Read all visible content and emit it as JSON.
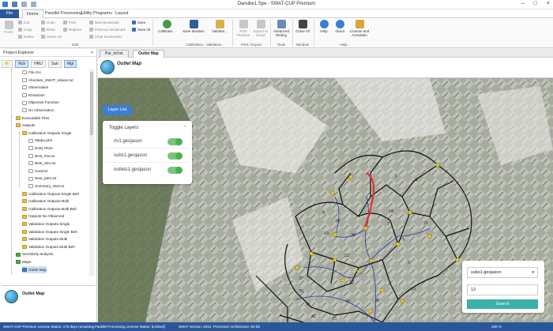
{
  "window": {
    "title": "Danube1.Spe - SWAT-CUP Premium"
  },
  "tabs": {
    "file": "File",
    "home": "Home",
    "parallel": "Parallel Processing",
    "utility": "Utility Programs",
    "layout": "Layout"
  },
  "ribbon": {
    "paste": "Paste",
    "cut": "Cut",
    "copy": "Copy",
    "delete": "Delete",
    "undo": "Undo",
    "redo": "Redo",
    "select_all": "Select All",
    "find": "Find",
    "replace": "Replace",
    "next_bookmark": "Next Bookmark",
    "previous_bookmark": "Previous Bookmark",
    "clear_bookmarks": "Clear Bookmarks",
    "save": "Save",
    "save_all": "Save All",
    "calibrate": "Calibrate...",
    "save_iteration": "Save Iteration",
    "validate": "Validate...",
    "print_preview": "Print Preview",
    "export_excel": "Export to Excel",
    "advanced_writing": "Advanced Writing",
    "close_all": "Close All",
    "help": "Help",
    "about": "About",
    "license": "License and Activation",
    "group_edit": "Edit",
    "group_calibration": "Calibration - Validation",
    "group_print": "Print / Export",
    "group_tools": "Tools",
    "group_window": "Window",
    "group_help": "Help"
  },
  "explorer": {
    "title": "Project Explorer",
    "close": "×",
    "tabs": [
      "Rch",
      "HRU",
      "Sub",
      "Mgt"
    ],
    "items": [
      {
        "label": "File.Cio",
        "type": "file"
      },
      {
        "label": "Absolute_SWAT_Values.txt",
        "type": "file"
      },
      {
        "label": "Observation",
        "type": "file"
      },
      {
        "label": "Extraction",
        "type": "file"
      },
      {
        "label": "Objective Function",
        "type": "file"
      },
      {
        "label": "No Observation",
        "type": "file"
      },
      {
        "label": "Executable Files",
        "type": "folder"
      },
      {
        "label": "Outputs",
        "type": "folder"
      },
      {
        "label": "Calibration Outputs Single",
        "type": "folder"
      },
      {
        "label": "95ppu.plot",
        "type": "file"
      },
      {
        "label": "Dotty Plots",
        "type": "file"
      },
      {
        "label": "Best_Par.txt",
        "type": "file"
      },
      {
        "label": "Best_Sim.txt",
        "type": "file"
      },
      {
        "label": "Goal.txt",
        "type": "file"
      },
      {
        "label": "New_pars.txt",
        "type": "file"
      },
      {
        "label": "Summary_Stat.txt",
        "type": "file"
      },
      {
        "label": "Calibration Outputs Single Beh",
        "type": "folder"
      },
      {
        "label": "Calibration Outputs Multi",
        "type": "folder"
      },
      {
        "label": "Calibration Outputs Multi Beh",
        "type": "folder"
      },
      {
        "label": "Outputs No Observed",
        "type": "folder"
      },
      {
        "label": "Validation Outputs Single",
        "type": "folder"
      },
      {
        "label": "Validation Outputs Single Beh",
        "type": "folder"
      },
      {
        "label": "Validation Outputs Multi",
        "type": "folder"
      },
      {
        "label": "Validation Outputs Multi Beh",
        "type": "folder"
      },
      {
        "label": "Sensitivity analysis",
        "type": "green"
      },
      {
        "label": "Maps",
        "type": "green"
      },
      {
        "label": "Outlet Map",
        "type": "blue"
      }
    ],
    "preview_label": "Outlet Map"
  },
  "doc_tabs": [
    "Par_inf.txt",
    "Outlet Map"
  ],
  "map": {
    "title": "Outlet Map",
    "layer_button": "Layer List",
    "toggle_title": "Toggle Layers",
    "toggle_close": "×",
    "layers": [
      "riv1.geojason",
      "subs1.geojason",
      "outlets1.geojason"
    ],
    "search_select": "subs1.geojason",
    "search_value": "12",
    "search_button": "Search",
    "sub_numbers": [
      "1",
      "2",
      "18",
      "9",
      "10",
      "7",
      "6",
      "13",
      "36",
      "37",
      "39",
      "41",
      "40",
      "42",
      "53",
      "5",
      "12",
      "38",
      "15",
      "21",
      "22"
    ]
  },
  "status": {
    "license": "SWAT-CUP Premium License Status: 179 days remaining",
    "parallel": "Parallel Processing License Status: [Limited]",
    "version": "SWAT Version: 2012, Processor Architecture: 64-bit",
    "zoom": "100 %"
  },
  "colors": {
    "accent": "#2b579a",
    "highlight": "#e03030",
    "search_btn": "#3bb1a9",
    "toggle_on": "#4caf50"
  }
}
